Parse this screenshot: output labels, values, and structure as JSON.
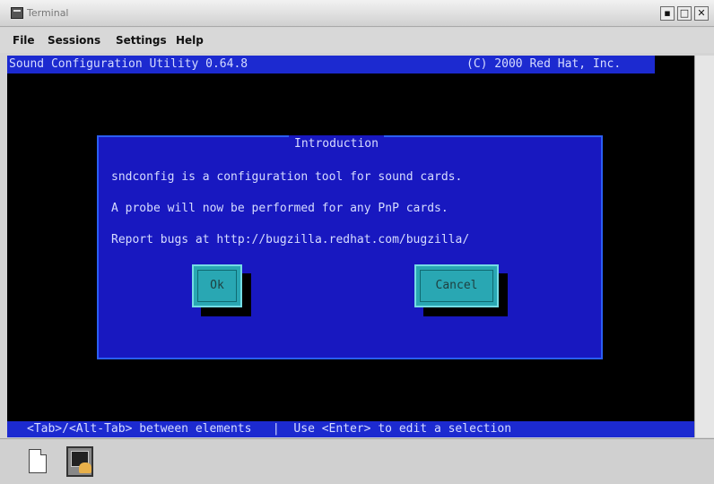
{
  "window": {
    "title": "Terminal",
    "controls": [
      "▪",
      "□",
      "✕"
    ]
  },
  "menu": [
    "File",
    "Sessions",
    "Settings",
    "Help"
  ],
  "terminal": {
    "header_left": "Sound Configuration Utility 0.64.8",
    "header_right": "(C) 2000 Red Hat, Inc.",
    "footer": "<Tab>/<Alt-Tab> between elements   |  Use <Enter> to edit a selection"
  },
  "dialog": {
    "title": "Introduction",
    "lines": [
      "sndconfig is a configuration tool for sound cards.",
      "A probe will now be performed for any PnP cards.",
      "Report bugs at http://bugzilla.redhat.com/bugzilla/"
    ],
    "ok_label": "Ok",
    "cancel_label": "Cancel"
  },
  "taskbar": {
    "icons": [
      "new-document-icon",
      "terminal-icon"
    ]
  }
}
